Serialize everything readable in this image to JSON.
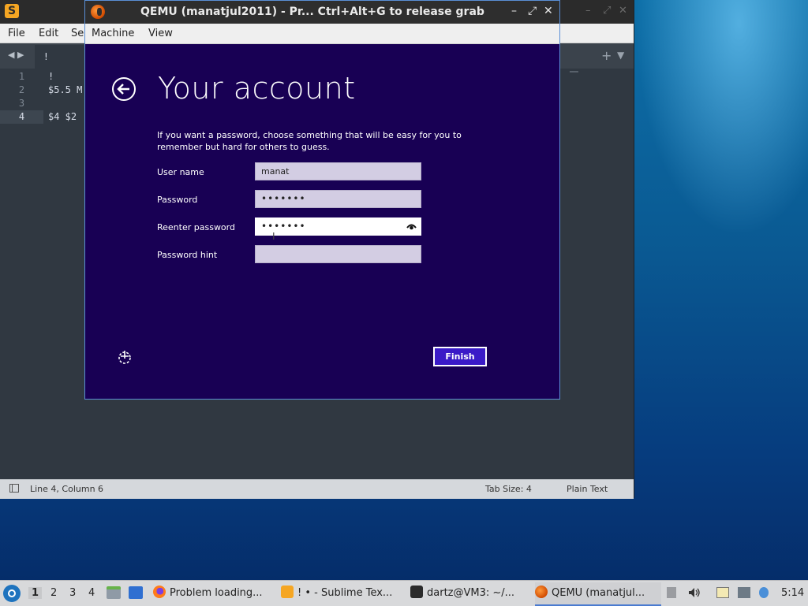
{
  "sublime": {
    "menu": {
      "file": "File",
      "edit": "Edit",
      "selection_partial": "Se"
    },
    "tab_label": "!",
    "lines": [
      {
        "num": "1",
        "text": "!"
      },
      {
        "num": "2",
        "text": "$5.5 M"
      },
      {
        "num": "3",
        "text": ""
      },
      {
        "num": "4",
        "text": "$4 $2"
      }
    ],
    "status": {
      "position": "Line 4, Column 6",
      "tab_size": "Tab Size: 4",
      "syntax": "Plain Text"
    }
  },
  "qemu": {
    "title": "QEMU (manatjul2011) - Pr...  Ctrl+Alt+G to release grab",
    "menu": {
      "machine": "Machine",
      "view": "View"
    },
    "setup": {
      "heading": "Your account",
      "description": "If you want a password, choose something that will be easy for you to remember but hard for others to guess.",
      "fields": {
        "username_label": "User name",
        "username_value": "manat",
        "password_label": "Password",
        "password_value": "•••••••",
        "reenter_label": "Reenter password",
        "reenter_value": "•••••••",
        "hint_label": "Password hint",
        "hint_value": ""
      },
      "finish_label": "Finish"
    }
  },
  "taskbar": {
    "workspaces": [
      "1",
      "2",
      "3",
      "4"
    ],
    "tasks": {
      "firefox": "Problem loading...",
      "sublime": "! • - Sublime Tex...",
      "terminal": "dartz@VM3: ~/...",
      "qemu": "QEMU (manatjul..."
    },
    "clock": "5:14"
  },
  "colors": {
    "guest_bg": "#180054",
    "finish_bg": "#3a1ac7",
    "field_bg": "#d3cde3"
  }
}
